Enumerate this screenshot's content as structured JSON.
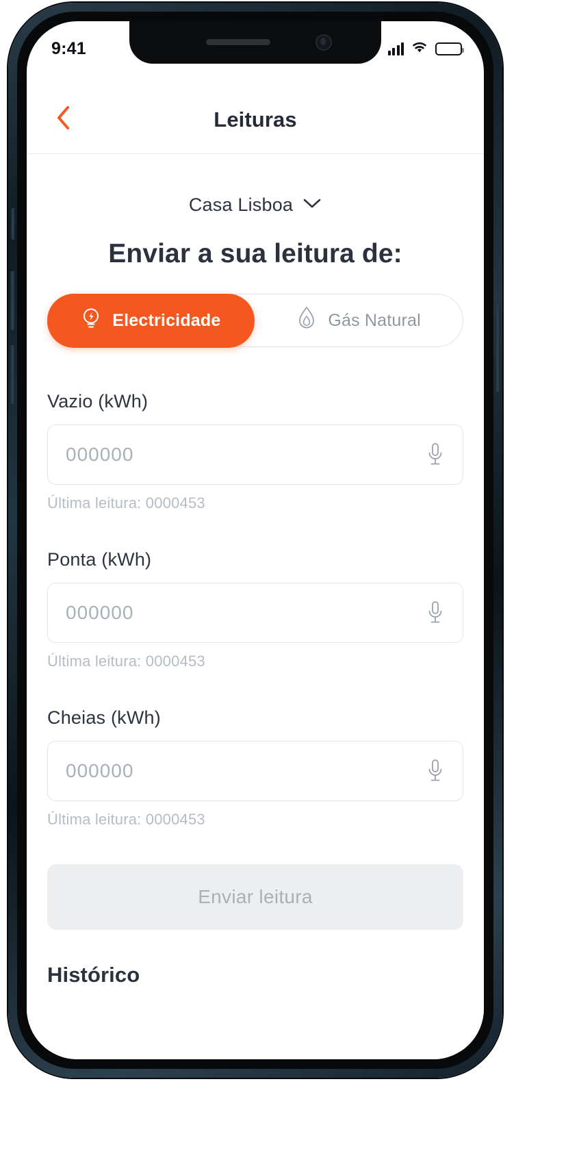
{
  "status_bar": {
    "time": "9:41",
    "signal_icon": "cellular-signal-icon",
    "wifi_icon": "wifi-icon",
    "battery_icon": "battery-icon"
  },
  "nav": {
    "back_icon": "chevron-left-icon",
    "title": "Leituras"
  },
  "house_selector": {
    "name": "Casa Lisboa",
    "chevron_icon": "chevron-down-icon"
  },
  "heading": "Enviar a sua leitura de:",
  "segmented_control": {
    "options": [
      {
        "label": "Electricidade",
        "icon": "lightbulb-icon",
        "active": true
      },
      {
        "label": "Gás Natural",
        "icon": "flame-icon",
        "active": false
      }
    ]
  },
  "fields": [
    {
      "label": "Vazio (kWh)",
      "value": "",
      "placeholder": "000000",
      "helper": "Última leitura: 0000453",
      "mic_icon": "microphone-icon"
    },
    {
      "label": "Ponta (kWh)",
      "value": "",
      "placeholder": "000000",
      "helper": "Última leitura: 0000453",
      "mic_icon": "microphone-icon"
    },
    {
      "label": "Cheias (kWh)",
      "value": "",
      "placeholder": "000000",
      "helper": "Última leitura: 0000453",
      "mic_icon": "microphone-icon"
    }
  ],
  "submit_button": {
    "label": "Enviar leitura",
    "enabled": false
  },
  "history": {
    "title": "Histórico"
  },
  "colors": {
    "accent": "#f4581f",
    "text_primary": "#2b313d",
    "text_muted": "#b6bcc4",
    "border": "#e3e6ea",
    "disabled_bg": "#eceef0"
  }
}
